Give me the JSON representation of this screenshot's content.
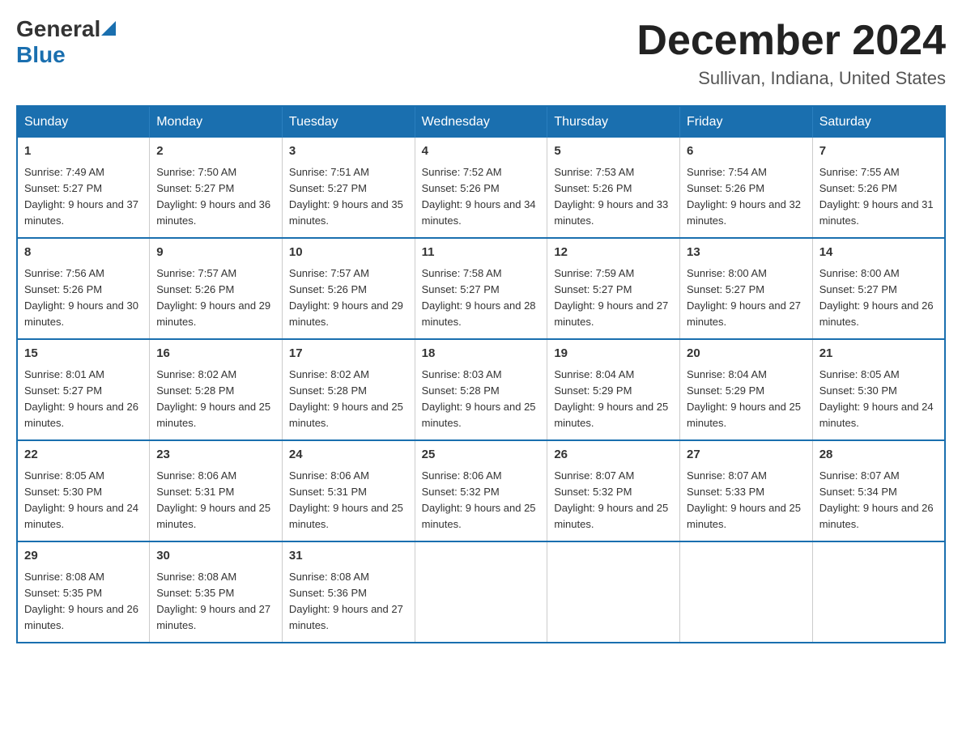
{
  "header": {
    "logo": {
      "general": "General",
      "blue": "Blue"
    },
    "title": "December 2024",
    "location": "Sullivan, Indiana, United States"
  },
  "calendar": {
    "days_of_week": [
      "Sunday",
      "Monday",
      "Tuesday",
      "Wednesday",
      "Thursday",
      "Friday",
      "Saturday"
    ],
    "weeks": [
      [
        {
          "day": "1",
          "sunrise": "Sunrise: 7:49 AM",
          "sunset": "Sunset: 5:27 PM",
          "daylight": "Daylight: 9 hours and 37 minutes."
        },
        {
          "day": "2",
          "sunrise": "Sunrise: 7:50 AM",
          "sunset": "Sunset: 5:27 PM",
          "daylight": "Daylight: 9 hours and 36 minutes."
        },
        {
          "day": "3",
          "sunrise": "Sunrise: 7:51 AM",
          "sunset": "Sunset: 5:27 PM",
          "daylight": "Daylight: 9 hours and 35 minutes."
        },
        {
          "day": "4",
          "sunrise": "Sunrise: 7:52 AM",
          "sunset": "Sunset: 5:26 PM",
          "daylight": "Daylight: 9 hours and 34 minutes."
        },
        {
          "day": "5",
          "sunrise": "Sunrise: 7:53 AM",
          "sunset": "Sunset: 5:26 PM",
          "daylight": "Daylight: 9 hours and 33 minutes."
        },
        {
          "day": "6",
          "sunrise": "Sunrise: 7:54 AM",
          "sunset": "Sunset: 5:26 PM",
          "daylight": "Daylight: 9 hours and 32 minutes."
        },
        {
          "day": "7",
          "sunrise": "Sunrise: 7:55 AM",
          "sunset": "Sunset: 5:26 PM",
          "daylight": "Daylight: 9 hours and 31 minutes."
        }
      ],
      [
        {
          "day": "8",
          "sunrise": "Sunrise: 7:56 AM",
          "sunset": "Sunset: 5:26 PM",
          "daylight": "Daylight: 9 hours and 30 minutes."
        },
        {
          "day": "9",
          "sunrise": "Sunrise: 7:57 AM",
          "sunset": "Sunset: 5:26 PM",
          "daylight": "Daylight: 9 hours and 29 minutes."
        },
        {
          "day": "10",
          "sunrise": "Sunrise: 7:57 AM",
          "sunset": "Sunset: 5:26 PM",
          "daylight": "Daylight: 9 hours and 29 minutes."
        },
        {
          "day": "11",
          "sunrise": "Sunrise: 7:58 AM",
          "sunset": "Sunset: 5:27 PM",
          "daylight": "Daylight: 9 hours and 28 minutes."
        },
        {
          "day": "12",
          "sunrise": "Sunrise: 7:59 AM",
          "sunset": "Sunset: 5:27 PM",
          "daylight": "Daylight: 9 hours and 27 minutes."
        },
        {
          "day": "13",
          "sunrise": "Sunrise: 8:00 AM",
          "sunset": "Sunset: 5:27 PM",
          "daylight": "Daylight: 9 hours and 27 minutes."
        },
        {
          "day": "14",
          "sunrise": "Sunrise: 8:00 AM",
          "sunset": "Sunset: 5:27 PM",
          "daylight": "Daylight: 9 hours and 26 minutes."
        }
      ],
      [
        {
          "day": "15",
          "sunrise": "Sunrise: 8:01 AM",
          "sunset": "Sunset: 5:27 PM",
          "daylight": "Daylight: 9 hours and 26 minutes."
        },
        {
          "day": "16",
          "sunrise": "Sunrise: 8:02 AM",
          "sunset": "Sunset: 5:28 PM",
          "daylight": "Daylight: 9 hours and 25 minutes."
        },
        {
          "day": "17",
          "sunrise": "Sunrise: 8:02 AM",
          "sunset": "Sunset: 5:28 PM",
          "daylight": "Daylight: 9 hours and 25 minutes."
        },
        {
          "day": "18",
          "sunrise": "Sunrise: 8:03 AM",
          "sunset": "Sunset: 5:28 PM",
          "daylight": "Daylight: 9 hours and 25 minutes."
        },
        {
          "day": "19",
          "sunrise": "Sunrise: 8:04 AM",
          "sunset": "Sunset: 5:29 PM",
          "daylight": "Daylight: 9 hours and 25 minutes."
        },
        {
          "day": "20",
          "sunrise": "Sunrise: 8:04 AM",
          "sunset": "Sunset: 5:29 PM",
          "daylight": "Daylight: 9 hours and 25 minutes."
        },
        {
          "day": "21",
          "sunrise": "Sunrise: 8:05 AM",
          "sunset": "Sunset: 5:30 PM",
          "daylight": "Daylight: 9 hours and 24 minutes."
        }
      ],
      [
        {
          "day": "22",
          "sunrise": "Sunrise: 8:05 AM",
          "sunset": "Sunset: 5:30 PM",
          "daylight": "Daylight: 9 hours and 24 minutes."
        },
        {
          "day": "23",
          "sunrise": "Sunrise: 8:06 AM",
          "sunset": "Sunset: 5:31 PM",
          "daylight": "Daylight: 9 hours and 25 minutes."
        },
        {
          "day": "24",
          "sunrise": "Sunrise: 8:06 AM",
          "sunset": "Sunset: 5:31 PM",
          "daylight": "Daylight: 9 hours and 25 minutes."
        },
        {
          "day": "25",
          "sunrise": "Sunrise: 8:06 AM",
          "sunset": "Sunset: 5:32 PM",
          "daylight": "Daylight: 9 hours and 25 minutes."
        },
        {
          "day": "26",
          "sunrise": "Sunrise: 8:07 AM",
          "sunset": "Sunset: 5:32 PM",
          "daylight": "Daylight: 9 hours and 25 minutes."
        },
        {
          "day": "27",
          "sunrise": "Sunrise: 8:07 AM",
          "sunset": "Sunset: 5:33 PM",
          "daylight": "Daylight: 9 hours and 25 minutes."
        },
        {
          "day": "28",
          "sunrise": "Sunrise: 8:07 AM",
          "sunset": "Sunset: 5:34 PM",
          "daylight": "Daylight: 9 hours and 26 minutes."
        }
      ],
      [
        {
          "day": "29",
          "sunrise": "Sunrise: 8:08 AM",
          "sunset": "Sunset: 5:35 PM",
          "daylight": "Daylight: 9 hours and 26 minutes."
        },
        {
          "day": "30",
          "sunrise": "Sunrise: 8:08 AM",
          "sunset": "Sunset: 5:35 PM",
          "daylight": "Daylight: 9 hours and 27 minutes."
        },
        {
          "day": "31",
          "sunrise": "Sunrise: 8:08 AM",
          "sunset": "Sunset: 5:36 PM",
          "daylight": "Daylight: 9 hours and 27 minutes."
        },
        null,
        null,
        null,
        null
      ]
    ]
  }
}
